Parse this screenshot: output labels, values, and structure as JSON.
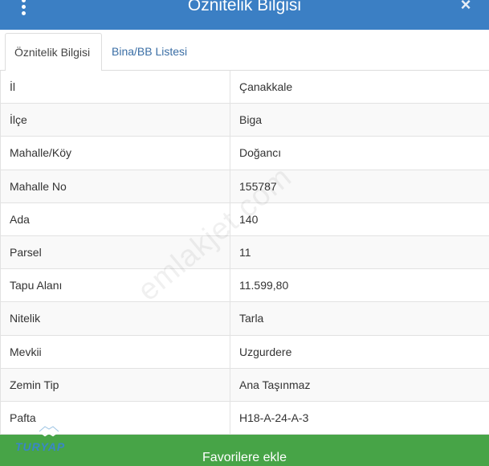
{
  "header": {
    "title": "Öznitelik Bilgisi",
    "close_label": "×"
  },
  "tabs": [
    {
      "label": "Öznitelik Bilgisi",
      "active": true
    },
    {
      "label": "Bina/BB Listesi",
      "active": false
    }
  ],
  "rows": [
    {
      "label": "İl",
      "value": "Çanakkale"
    },
    {
      "label": "İlçe",
      "value": "Biga"
    },
    {
      "label": "Mahalle/Köy",
      "value": "Doğancı"
    },
    {
      "label": "Mahalle No",
      "value": "155787"
    },
    {
      "label": "Ada",
      "value": "140"
    },
    {
      "label": "Parsel",
      "value": "11"
    },
    {
      "label": "Tapu Alanı",
      "value": "11.599,80"
    },
    {
      "label": "Nitelik",
      "value": "Tarla"
    },
    {
      "label": "Mevkii",
      "value": "Uzgurdere"
    },
    {
      "label": "Zemin Tip",
      "value": "Ana Taşınmaz"
    },
    {
      "label": "Pafta",
      "value": "H18-A-24-A-3"
    }
  ],
  "favorite_button": {
    "label": "Favorilere ekle"
  },
  "watermark": "emlakjet.com",
  "logo": {
    "text": "TURYAP"
  },
  "colors": {
    "header_bg": "#3b7fc4",
    "button_bg": "#47a447",
    "tab_link": "#3a6ea5"
  }
}
